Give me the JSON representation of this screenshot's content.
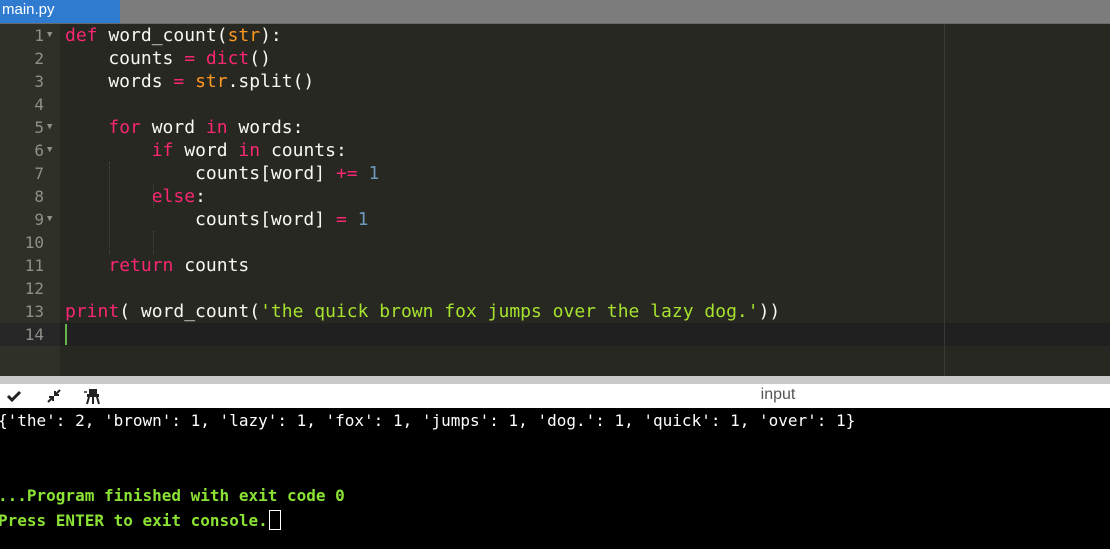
{
  "tab": {
    "filename": "main.py"
  },
  "editor": {
    "line_numbers": [
      "1",
      "2",
      "3",
      "4",
      "5",
      "6",
      "7",
      "8",
      "9",
      "10",
      "11",
      "12",
      "13",
      "14"
    ],
    "code": {
      "l1": {
        "def": "def",
        "fname": " word_count(",
        "param": "str",
        "close": "):"
      },
      "l2": {
        "a": "    counts ",
        "eq": "=",
        "sp": " ",
        "dict": "dict",
        "paren": "()"
      },
      "l3": {
        "a": "    words ",
        "eq": "=",
        "sp": " ",
        "str": "str",
        "rest": ".split()"
      },
      "l5": {
        "ind": "    ",
        "for": "for",
        "mid": " word ",
        "in": "in",
        "rest": " words:"
      },
      "l6": {
        "ind": "        ",
        "if": "if",
        "mid": " word ",
        "in": "in",
        "rest": " counts:"
      },
      "l7": {
        "a": "            counts[word] ",
        "op": "+=",
        "sp": " ",
        "num": "1"
      },
      "l8": {
        "ind": "        ",
        "else": "else",
        "colon": ":"
      },
      "l9": {
        "a": "            counts[word] ",
        "op": "=",
        "sp": " ",
        "num": "1"
      },
      "l11": {
        "ind": "    ",
        "ret": "return",
        "rest": " counts"
      },
      "l13": {
        "print": "print",
        "mid": "( word_count(",
        "str": "'the quick brown fox jumps over the lazy dog.'",
        "close": "))"
      }
    }
  },
  "console_toolbar": {
    "input_label": "input",
    "icons": [
      "check-icon",
      "collapse-icon",
      "clear-console-icon"
    ]
  },
  "console": {
    "output": "{'the': 2, 'brown': 1, 'lazy': 1, 'fox': 1, 'jumps': 1, 'dog.': 1, 'quick': 1, 'over': 1}",
    "finished": "...Program finished with exit code 0",
    "press_enter": "Press ENTER to exit console."
  },
  "colors": {
    "tab_active": "#2e7bcf",
    "editor_bg": "#272822",
    "keyword": "#f92672",
    "builtin": "#fd971f",
    "string": "#a6e22e",
    "number": "#6c99bb",
    "console_status": "#8ae234"
  }
}
